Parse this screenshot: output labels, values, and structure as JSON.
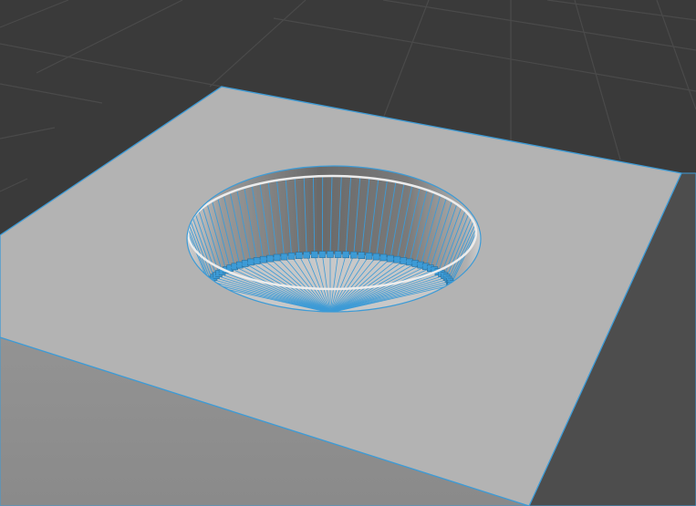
{
  "viewport": {
    "name": "3D Viewport",
    "background_color": "#3a3a3a",
    "grid_color": "#4a4a4a"
  },
  "object": {
    "type": "box-with-hole",
    "selected_edges": true,
    "top_face_color": "#b3b3b3",
    "front_face_color": "#8f8f8f",
    "side_face_color": "#4d4d4d",
    "edge_highlight_color": "#3d9bd6",
    "hole": {
      "inner_wall_dark": "#6a6a6a",
      "inner_wall_light": "#b8b8b8",
      "rim_color": "#e8e8e8",
      "bottom_color": "#c8c8c8",
      "wall_segments": 48,
      "bottom_fan_segments": 48
    }
  }
}
